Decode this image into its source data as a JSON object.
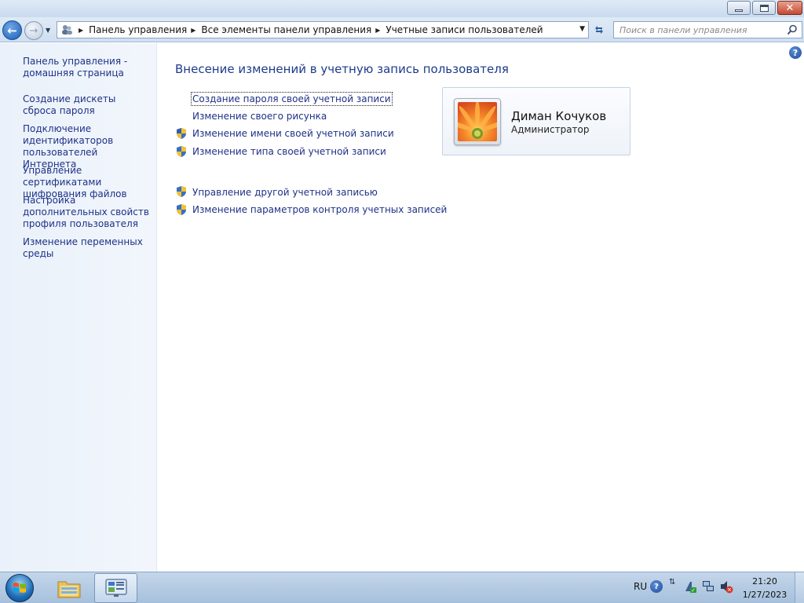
{
  "window": {
    "minimize_label": "",
    "close_label": ""
  },
  "navbar": {
    "breadcrumbs": [
      "Панель управления",
      "Все элементы панели управления",
      "Учетные записи пользователей"
    ],
    "search_placeholder": "Поиск в панели управления"
  },
  "sidebar": {
    "items": [
      "Панель управления - домашняя страница",
      "Создание дискеты сброса пароля",
      "Подключение идентификаторов пользователей Интернета",
      "Управление сертификатами шифрования файлов",
      "Настройка дополнительных свойств профиля пользователя",
      "Изменение переменных среды"
    ]
  },
  "main": {
    "title": "Внесение изменений в учетную запись пользователя",
    "tasks": [
      {
        "label": "Создание пароля своей учетной записи",
        "shield": false
      },
      {
        "label": "Изменение своего рисунка",
        "shield": false
      },
      {
        "label": "Изменение имени своей учетной записи",
        "shield": true
      },
      {
        "label": "Изменение типа своей учетной записи",
        "shield": true
      }
    ],
    "other_tasks": [
      {
        "label": "Управление другой учетной записью",
        "shield": true
      },
      {
        "label": "Изменение параметров контроля учетных записей",
        "shield": true
      }
    ]
  },
  "user": {
    "name": "Диман Кочуков",
    "role": "Администратор"
  },
  "taskbar": {
    "language": "RU",
    "time": "21:20",
    "date": "1/27/2023"
  },
  "colors": {
    "link": "#1e3287",
    "title": "#1e3a8a",
    "sidebar_bg": "#eaf1fa"
  }
}
